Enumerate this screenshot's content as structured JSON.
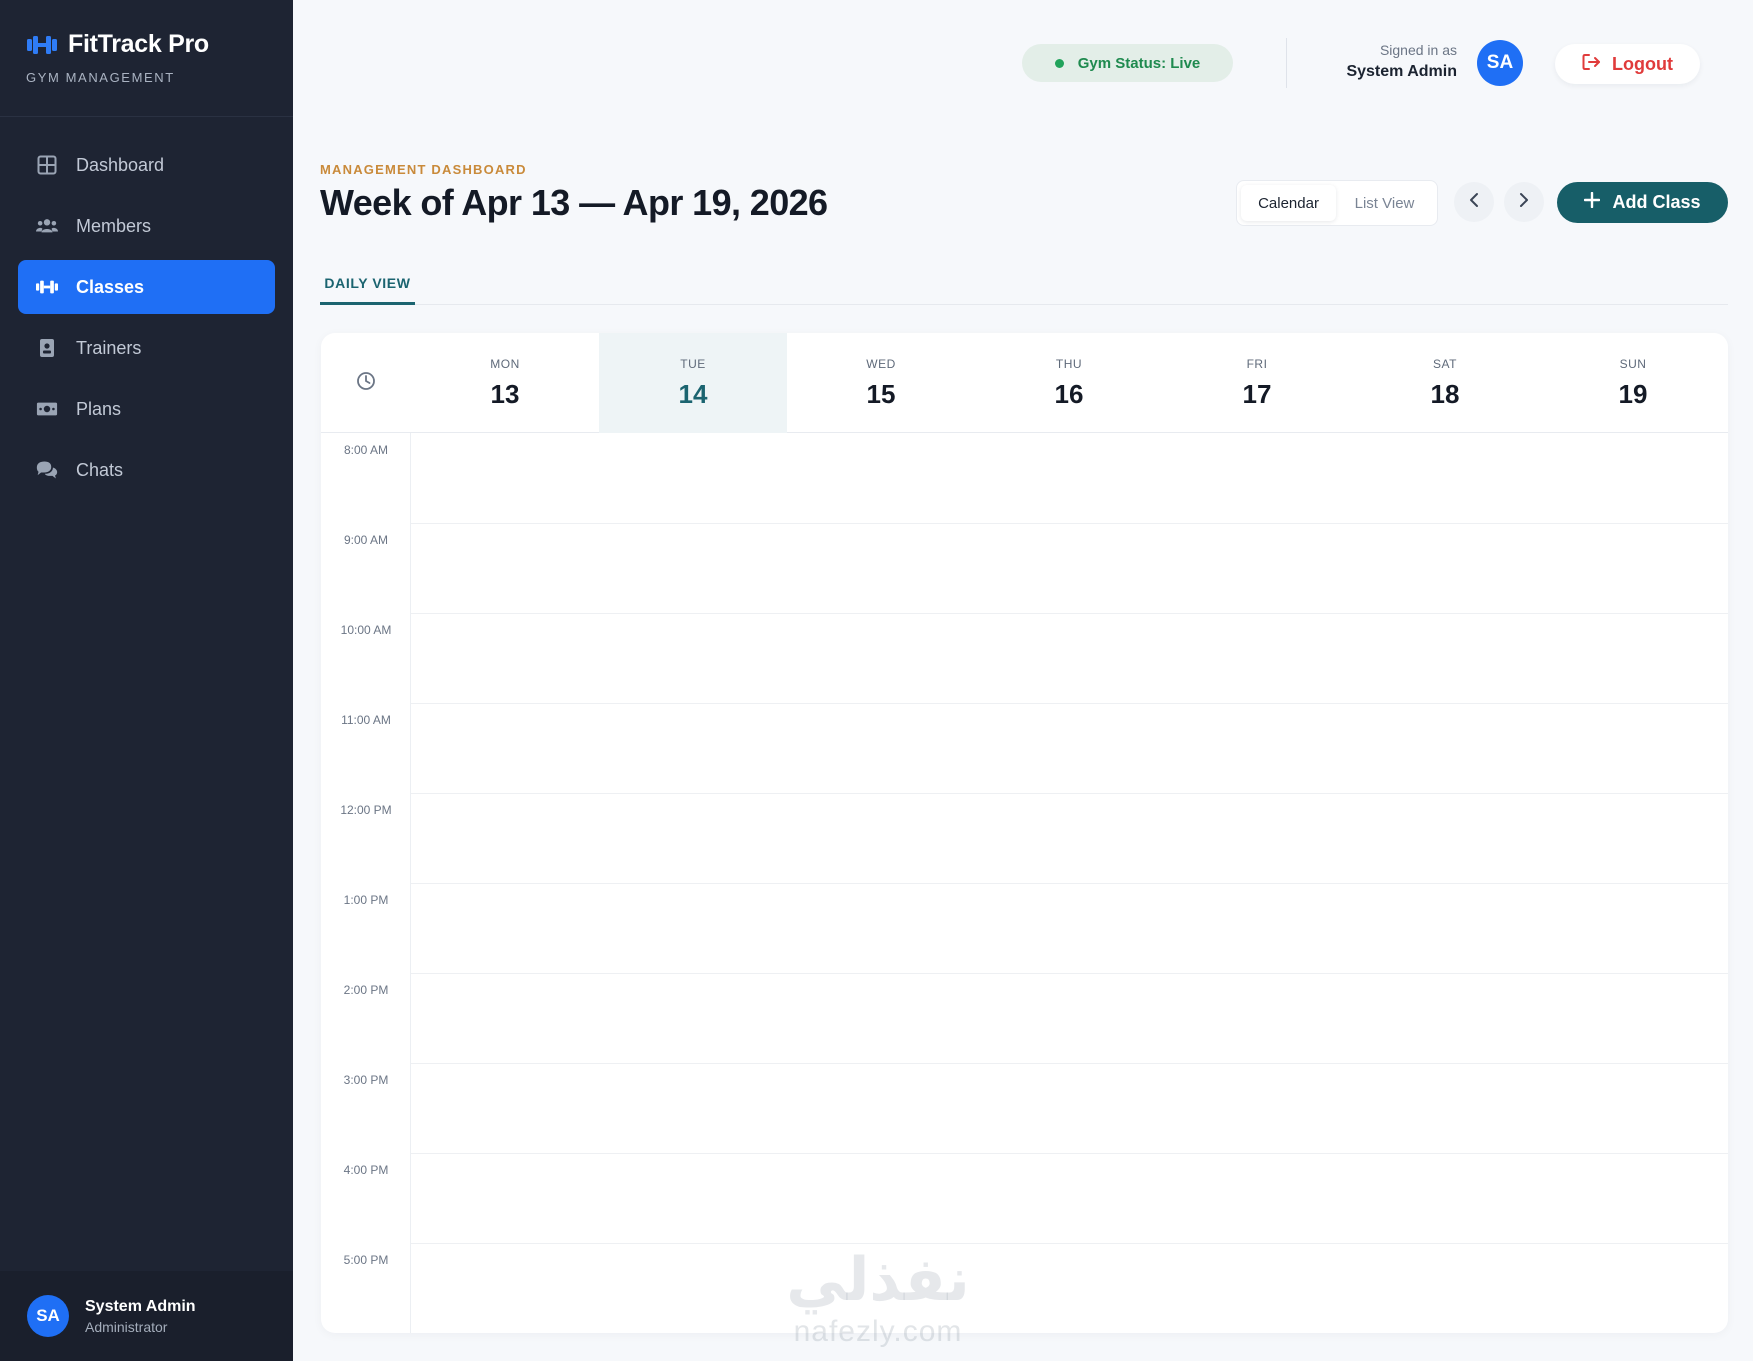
{
  "brand": {
    "title": "FitTrack Pro",
    "subtitle": "GYM MANAGEMENT"
  },
  "sidebar": {
    "items": [
      {
        "label": "Dashboard",
        "icon": "grid-icon",
        "active": false
      },
      {
        "label": "Members",
        "icon": "users-icon",
        "active": false
      },
      {
        "label": "Classes",
        "icon": "dumbbell-icon",
        "active": true
      },
      {
        "label": "Trainers",
        "icon": "id-badge-icon",
        "active": false
      },
      {
        "label": "Plans",
        "icon": "money-icon",
        "active": false
      },
      {
        "label": "Chats",
        "icon": "chat-icon",
        "active": false
      }
    ],
    "user": {
      "initials": "SA",
      "name": "System Admin",
      "role": "Administrator"
    }
  },
  "topbar": {
    "status": "Gym Status: Live",
    "signed_in_label": "Signed in as",
    "signed_in_name": "System Admin",
    "avatar_initials": "SA",
    "logout_label": "Logout"
  },
  "header": {
    "eyebrow": "MANAGEMENT DASHBOARD",
    "title": "Week of Apr 13 — Apr 19, 2026",
    "view_calendar": "Calendar",
    "view_list": "List View",
    "add_class": "Add Class"
  },
  "tabs": {
    "daily": "DAILY VIEW"
  },
  "calendar": {
    "days": [
      {
        "name": "MON",
        "num": "13",
        "today": false
      },
      {
        "name": "TUE",
        "num": "14",
        "today": true
      },
      {
        "name": "WED",
        "num": "15",
        "today": false
      },
      {
        "name": "THU",
        "num": "16",
        "today": false
      },
      {
        "name": "FRI",
        "num": "17",
        "today": false
      },
      {
        "name": "SAT",
        "num": "18",
        "today": false
      },
      {
        "name": "SUN",
        "num": "19",
        "today": false
      }
    ],
    "times": [
      "8:00 AM",
      "9:00 AM",
      "10:00 AM",
      "11:00 AM",
      "12:00 PM",
      "1:00 PM",
      "2:00 PM",
      "3:00 PM",
      "4:00 PM",
      "5:00 PM"
    ]
  },
  "colors": {
    "sidebar_bg": "#1e2433",
    "accent_blue": "#1f6ff5",
    "accent_teal": "#175e68",
    "eyebrow": "#c98a3a",
    "status_green": "#1f8a4f",
    "logout_red": "#e03b3b"
  },
  "watermark": {
    "arabic": "نفذلي",
    "latin": "nafezly.com"
  }
}
